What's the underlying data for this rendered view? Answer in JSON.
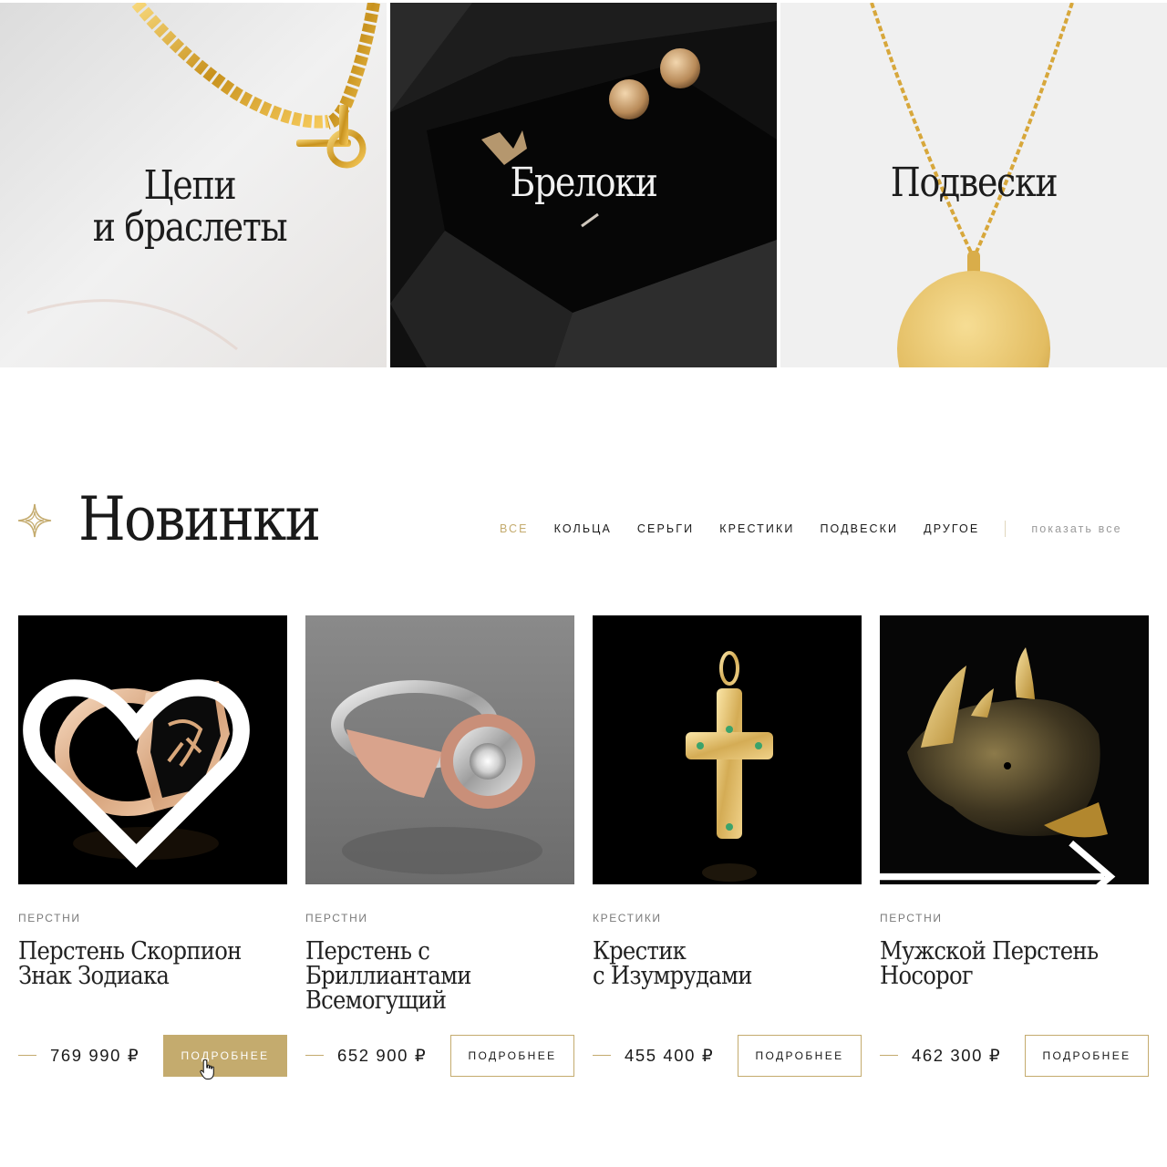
{
  "categories": [
    {
      "id": "chains",
      "title_line1": "Цепи",
      "title_line2": "и браслеты"
    },
    {
      "id": "charms",
      "title_line1": "Брелоки",
      "title_line2": ""
    },
    {
      "id": "pendants",
      "title_line1": "Подвески",
      "title_line2": ""
    }
  ],
  "new_section": {
    "title": "Новинки",
    "filters": [
      "все",
      "кольца",
      "серьги",
      "крестики",
      "подвески",
      "другое"
    ],
    "active_filter": "все",
    "show_all": "показать все"
  },
  "products": [
    {
      "category": "перстни",
      "name_line1": "Перстень Скорпион",
      "name_line2": "Знак Зодиака",
      "name_line3": "",
      "price": "769 990 ₽",
      "button": "подробнее",
      "button_state": "hover"
    },
    {
      "category": "перстни",
      "name_line1": "Перстень с",
      "name_line2": "Бриллиантами",
      "name_line3": "Всемогущий",
      "price": "652 900 ₽",
      "button": "подробнее",
      "button_state": "default"
    },
    {
      "category": "крестики",
      "name_line1": "Крестик",
      "name_line2": "с Изумрудами",
      "name_line3": "",
      "price": "455 400 ₽",
      "button": "подробнее",
      "button_state": "default"
    },
    {
      "category": "перстни",
      "name_line1": "Мужской Перстень",
      "name_line2": "Носорог",
      "name_line3": "",
      "price": "462 300 ₽",
      "button": "подробнее",
      "button_state": "default"
    }
  ],
  "icons": {
    "wishlist": "heart-icon",
    "carousel_next": "arrow-right-icon",
    "section_mark": "sparkle-icon",
    "pointer": "hand-cursor-icon"
  },
  "colors": {
    "accent": "#c4ab6e",
    "text": "#1a1a1a",
    "muted": "#9a9a9a"
  }
}
